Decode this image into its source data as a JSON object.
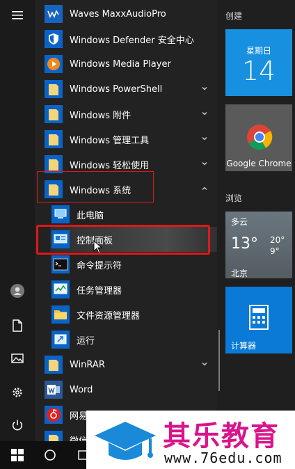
{
  "applist": {
    "items": [
      {
        "label": "Waves MaxxAudioPro",
        "icon": "waves-icon"
      },
      {
        "label": "Windows Defender 安全中心",
        "icon": "shield-icon"
      },
      {
        "label": "Windows Media Player",
        "icon": "media-player-icon"
      },
      {
        "label": "Windows PowerShell",
        "icon": "folder-icon"
      },
      {
        "label": "Windows 附件",
        "icon": "folder-icon"
      },
      {
        "label": "Windows 管理工具",
        "icon": "folder-icon"
      },
      {
        "label": "Windows 轻松使用",
        "icon": "folder-icon"
      },
      {
        "label": "Windows 系统",
        "icon": "folder-icon"
      },
      {
        "label": "此电脑",
        "icon": "computer-icon"
      },
      {
        "label": "控制面板",
        "icon": "control-panel-icon"
      },
      {
        "label": "命令提示符",
        "icon": "command-prompt-icon"
      },
      {
        "label": "任务管理器",
        "icon": "task-manager-icon"
      },
      {
        "label": "文件资源管理器",
        "icon": "file-explorer-icon"
      },
      {
        "label": "运行",
        "icon": "run-icon"
      },
      {
        "label": "WinRAR",
        "icon": "folder-icon"
      },
      {
        "label": "Word",
        "icon": "word-icon"
      },
      {
        "label": "网易云音乐",
        "icon": "netease-music-icon"
      },
      {
        "label": "微信",
        "icon": "folder-icon"
      }
    ]
  },
  "tiles": {
    "group1_title": "创建",
    "calendar_day": "星期日",
    "calendar_date": "14",
    "chrome_label": "Google Chrome",
    "group2_title": "浏览",
    "weather_condition": "多云",
    "weather_temp": "13°",
    "weather_high": "20°",
    "weather_low": "9°",
    "weather_city": "北京",
    "calculator_label": "计算器"
  },
  "watermark": {
    "text": "其乐教育",
    "url": "www.76edu.com"
  },
  "colors": {
    "accent": "#0a64c8",
    "highlight_box": "#e01818"
  }
}
